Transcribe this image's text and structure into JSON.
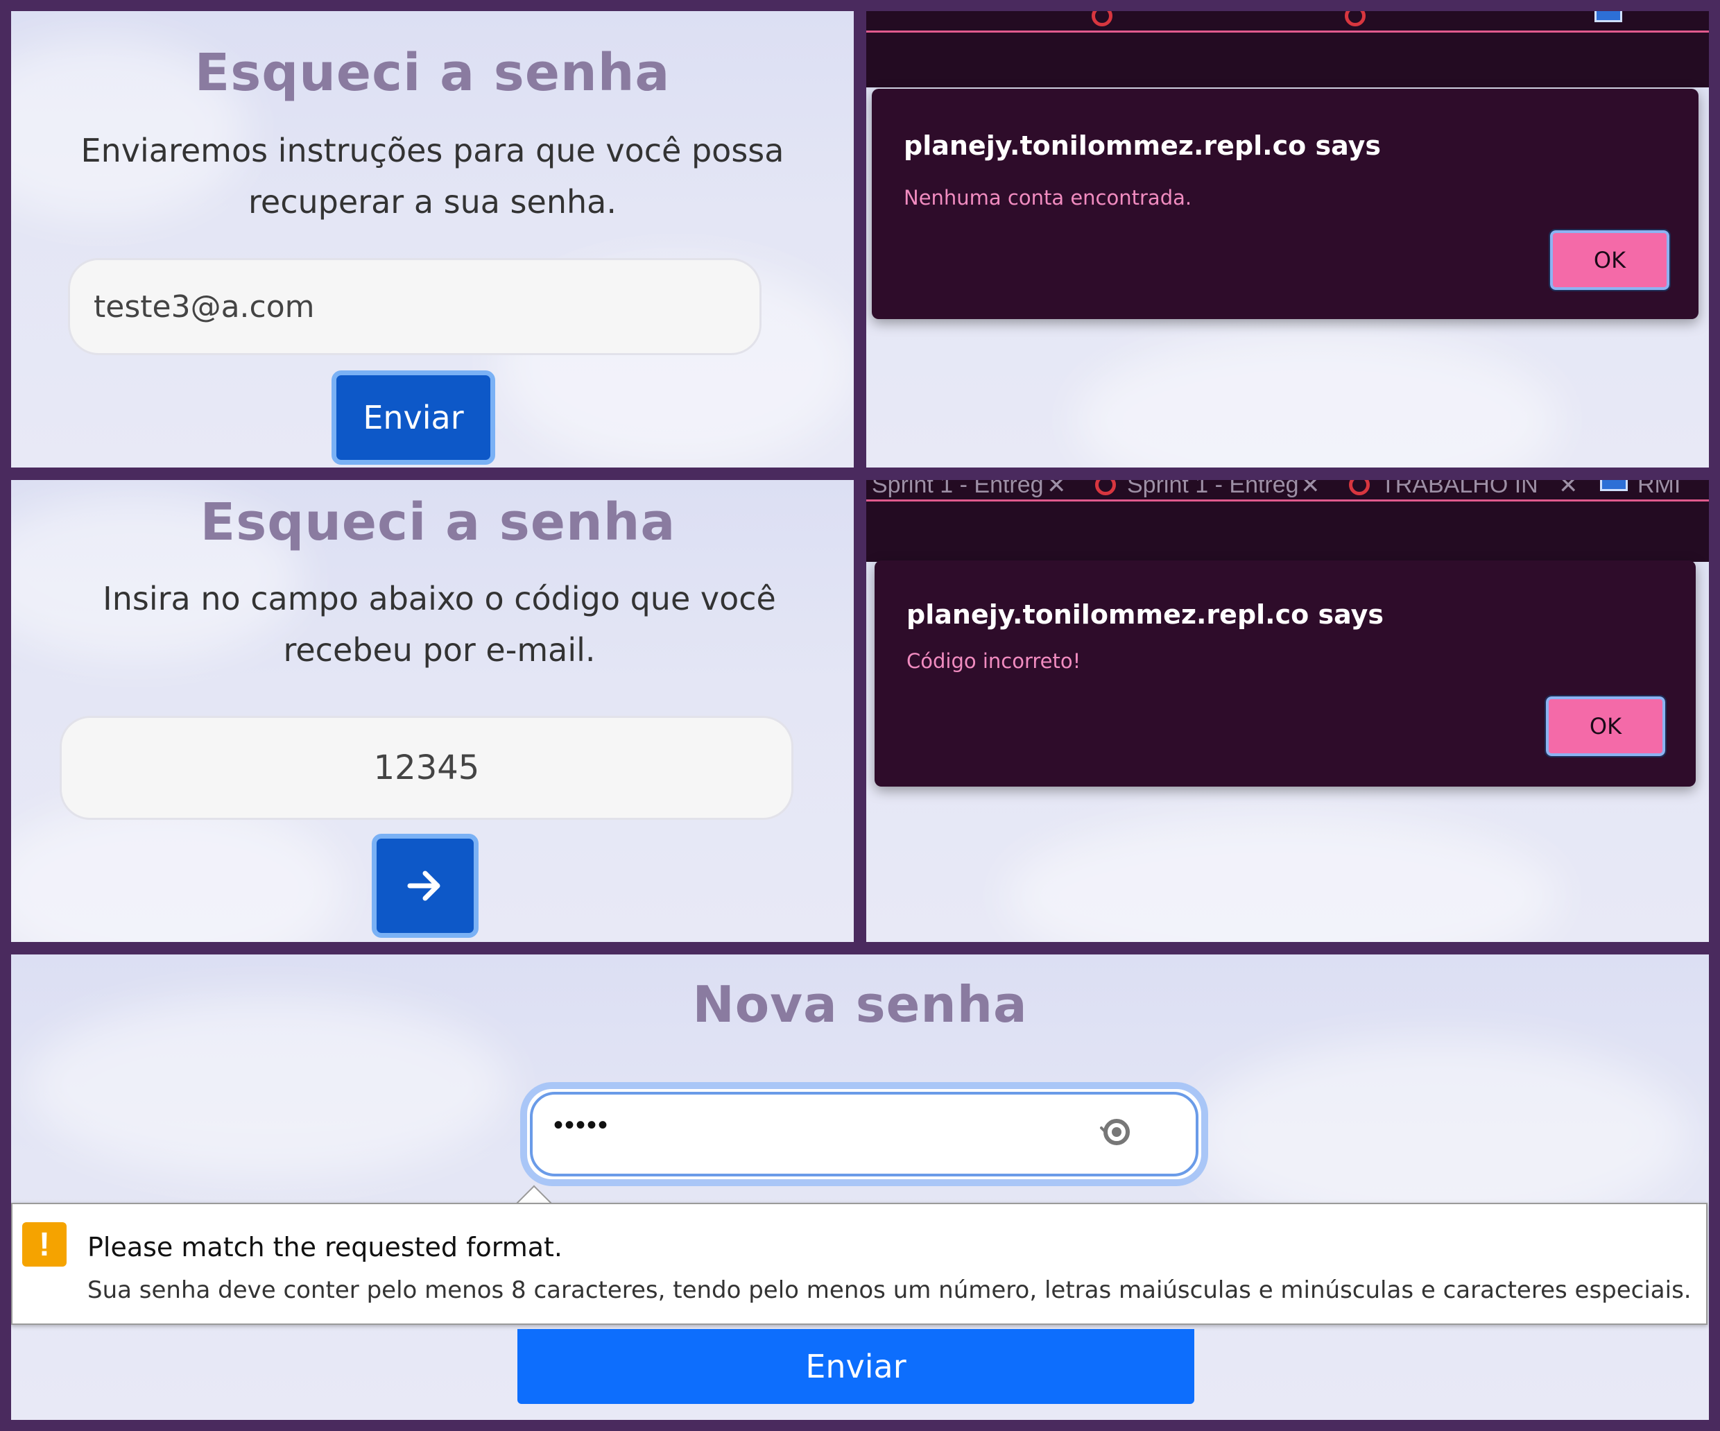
{
  "forgot_email": {
    "title": "Esqueci a senha",
    "instructions": "Enviaremos instruções para que você possa recuperar a sua senha.",
    "email_value": "teste3@a.com",
    "submit_label": "Enviar"
  },
  "dialog_no_account": {
    "tabs": [],
    "title": "planejy.tonilommez.repl.co says",
    "message": "Nenhuma conta encontrada.",
    "ok_label": "OK"
  },
  "forgot_code": {
    "title": "Esqueci a senha",
    "instructions": "Insira no campo abaixo o código que você recebeu por e-mail.",
    "code_value": "12345",
    "submit_icon": "arrow-right-icon"
  },
  "dialog_wrong_code": {
    "tabs": [
      "Sprint 1 - Entreg",
      "Sprint 1 - Entreg",
      "TRABALHO IN",
      "RMI"
    ],
    "title": "planejy.tonilommez.repl.co says",
    "message": "Código incorreto!",
    "ok_label": "OK"
  },
  "new_password": {
    "title": "Nova senha",
    "password_value": "•••••",
    "validation_heading": "Please match the requested format.",
    "validation_detail": "Sua senha deve conter pelo menos 8 caracteres, tendo pelo menos um número, letras maiúsculas e minúsculas e caracteres especiais.",
    "submit_label": "Enviar"
  },
  "colors": {
    "frame": "#4a2a5e",
    "title_text": "#8a7ba0",
    "primary_button": "#0d58c8",
    "dialog_bg": "#2e0c2a",
    "dialog_message": "#f18cc0",
    "ok_button": "#f46aa8",
    "warning": "#f5a300"
  }
}
